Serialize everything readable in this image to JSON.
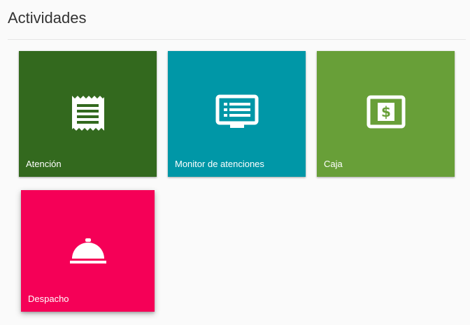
{
  "page": {
    "title": "Actividades"
  },
  "tiles": [
    {
      "label": "Atención",
      "icon": "receipt-icon",
      "color": "#33691e"
    },
    {
      "label": "Monitor de atenciones",
      "icon": "monitor-list-icon",
      "color": "#0097a7"
    },
    {
      "label": "Caja",
      "icon": "cash-icon",
      "color": "#689f38"
    },
    {
      "label": "Despacho",
      "icon": "room-service-icon",
      "color": "#f50057"
    }
  ]
}
